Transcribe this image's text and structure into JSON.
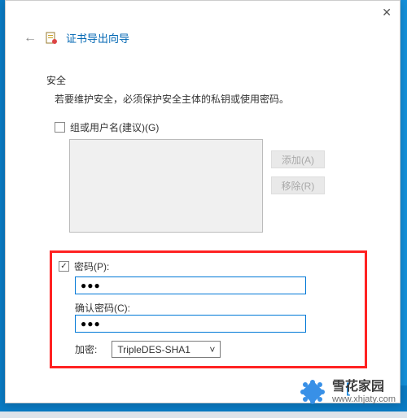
{
  "window": {
    "close_glyph": "✕",
    "back_glyph": "←",
    "title": "证书导出向导"
  },
  "security": {
    "heading": "安全",
    "description": "若要维护安全，必须保护安全主体的私钥或使用密码。"
  },
  "group_users": {
    "checkbox_checked": false,
    "label": "组或用户名(建议)(G)",
    "add_btn": "添加(A)",
    "remove_btn": "移除(R)"
  },
  "password": {
    "checkbox_checked": true,
    "check_glyph": "✓",
    "label": "密码(P):",
    "value_masked": "●●●",
    "confirm_label": "确认密码(C):",
    "confirm_value_masked": "●●●"
  },
  "encryption": {
    "label": "加密:",
    "selected": "TripleDES-SHA1",
    "chevron": "˅"
  },
  "watermark": {
    "name": "雪花家园",
    "url": "www.xhjaty.com"
  }
}
